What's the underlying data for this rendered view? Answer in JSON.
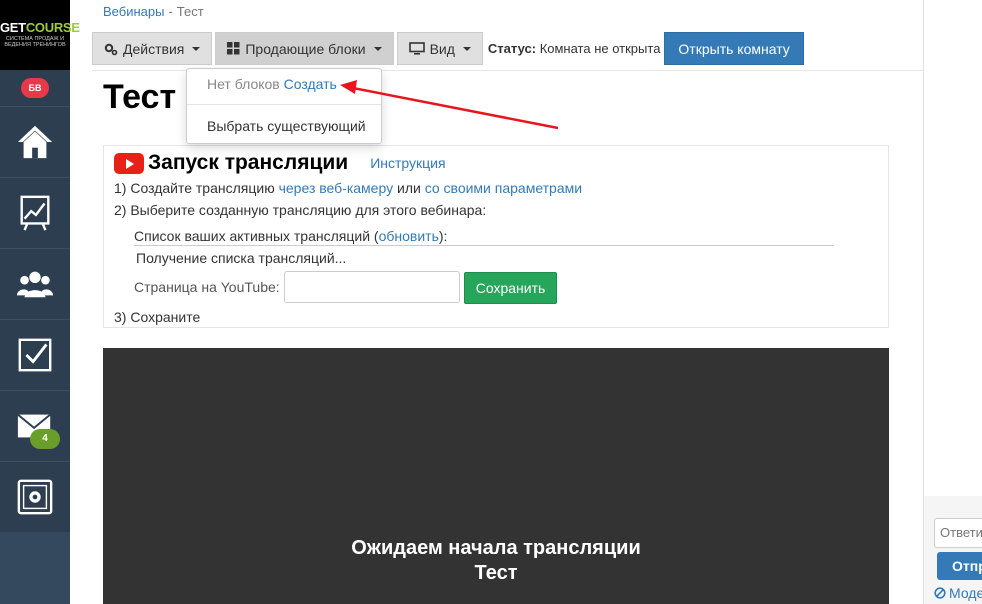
{
  "sidebar": {
    "logo_brand_a": "GET",
    "logo_brand_b": "COURSE",
    "logo_sub": "СИСТЕМА ПРОДАЖ И ВЕДЕНИЯ ТРЕНИНГОВ",
    "avatar_initials": "БВ",
    "mail_badge": "4",
    "items": [
      {
        "icon": "home-icon"
      },
      {
        "icon": "chart-icon"
      },
      {
        "icon": "users-icon"
      },
      {
        "icon": "tasks-icon"
      },
      {
        "icon": "mail-icon"
      },
      {
        "icon": "safe-icon"
      }
    ]
  },
  "breadcrumb": {
    "parent": "Вебинары",
    "separator": "-",
    "current": "Тест"
  },
  "toolbar": {
    "actions_label": "Действия",
    "blocks_label": "Продающие блоки",
    "view_label": "Вид",
    "status_label": "Статус:",
    "status_value": "Комната не открыта",
    "open_room_label": "Открыть комнату"
  },
  "dropdown": {
    "no_blocks": "Нет блоков",
    "create": "Создать",
    "choose_existing": "Выбрать существующий"
  },
  "page": {
    "title": "Тест"
  },
  "stream": {
    "title": "Запуск трансляции",
    "instruction_link": "Инструкция",
    "step1_prefix": "1) Создайте трансляцию",
    "step1_link1": "через веб-камеру",
    "step1_or": "или",
    "step1_link2": "со своими параметрами",
    "step2": "2) Выберите созданную трансляцию для этого вебинара:",
    "list_label": "Список ваших активных трансляций",
    "refresh_link": "обновить",
    "loading": "Получение списка трансляций...",
    "youtube_label": "Страница на YouTube:",
    "youtube_value": "",
    "save_label": "Сохранить",
    "step3": "3) Сохраните"
  },
  "video": {
    "line1": "Ожидаем начала трансляции",
    "line2": "Тест"
  },
  "right_panel": {
    "reply_placeholder": "Ответить",
    "send_label": "Отправить",
    "moderation_label": "Модерация"
  },
  "colors": {
    "sidebar_bg": "#2c3e50",
    "primary": "#337ab7",
    "success": "#26a65b",
    "badge_red": "#e8394b",
    "badge_green": "#6a9e2b",
    "arrow_red": "#e8141e"
  }
}
